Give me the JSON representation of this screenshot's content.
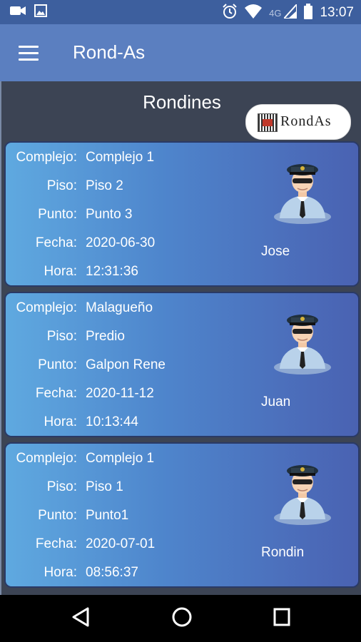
{
  "status_bar": {
    "network_type": "4G",
    "time": "13:07",
    "icons": [
      "video-camera-icon",
      "image-icon",
      "alarm-icon",
      "wifi-icon",
      "cell-signal-icon",
      "battery-icon"
    ]
  },
  "app_bar": {
    "title": "Rond-As",
    "menu_icon": "hamburger-menu-icon"
  },
  "page": {
    "title": "Rondines",
    "logo_text": "RondAs"
  },
  "labels": {
    "complejo": "Complejo:",
    "piso": "Piso:",
    "punto": "Punto:",
    "fecha": "Fecha:",
    "hora": "Hora:"
  },
  "rondines": [
    {
      "complejo": "Complejo 1",
      "piso": "Piso 2",
      "punto": "Punto 3",
      "fecha": "2020-06-30",
      "hora": "12:31:36",
      "guardia": "Jose"
    },
    {
      "complejo": "Malagueño",
      "piso": "Predio",
      "punto": "Galpon Rene",
      "fecha": "2020-11-12",
      "hora": "10:13:44",
      "guardia": "Juan"
    },
    {
      "complejo": "Complejo 1",
      "piso": "Piso 1",
      "punto": "Punto1",
      "fecha": "2020-07-01",
      "hora": "08:56:37",
      "guardia": "Rondin"
    }
  ],
  "colors": {
    "status_bar": "#3d5f9e",
    "app_bar": "#5b7fc0",
    "background": "#3c4454",
    "card_start": "#5fa9e0",
    "card_end": "#4a62b2"
  },
  "nav_bar": {
    "icons": [
      "back-icon",
      "home-icon",
      "recents-icon"
    ]
  }
}
